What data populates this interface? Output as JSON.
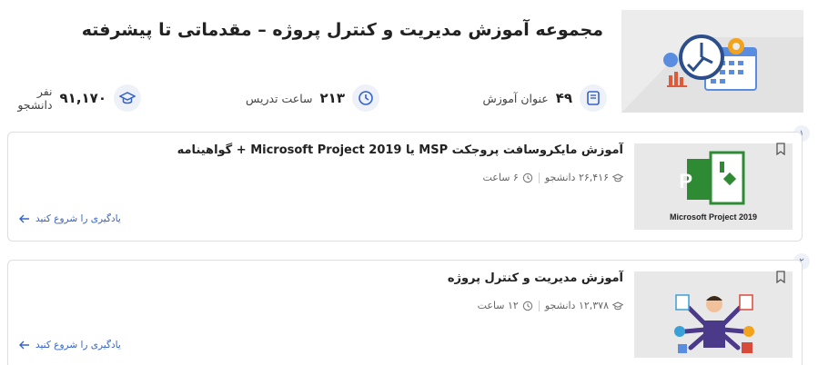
{
  "collection": {
    "title": "مجموعه آموزش مدیریت و کنترل پروژه – مقدماتی تا پیشرفته",
    "stats": {
      "lessons": {
        "number": "۴۹",
        "label": "عنوان آموزش"
      },
      "hours": {
        "number": "۲۱۳",
        "label": "ساعت تدریس"
      },
      "students": {
        "number": "۹۱,۱۷۰",
        "label": "نفر دانشجو"
      }
    }
  },
  "courses": [
    {
      "step": "۱",
      "title": "آموزش مایکروسافت پروجکت MSP یا Microsoft Project 2019 + گواهینامه",
      "students": "۲۶,۴۱۶ دانشجو",
      "duration": "۶ ساعت",
      "cta": "یادگیری را شروع کنید",
      "thumb_caption": "Microsoft Project 2019"
    },
    {
      "step": "۲",
      "title": "آموزش مدیریت و کنترل پروژه",
      "students": "۱۲,۳۷۸ دانشجو",
      "duration": "۱۲ ساعت",
      "cta": "یادگیری را شروع کنید"
    }
  ],
  "icons": {
    "lessons": "book-icon",
    "hours": "clock-icon",
    "students": "graduation-cap-icon",
    "bookmark": "bookmark-icon",
    "cta_arrow": "arrow-left-icon"
  },
  "colors": {
    "accent": "#3563c9",
    "icon_bg": "#eef1f8",
    "msp_green": "#2e8b34"
  }
}
